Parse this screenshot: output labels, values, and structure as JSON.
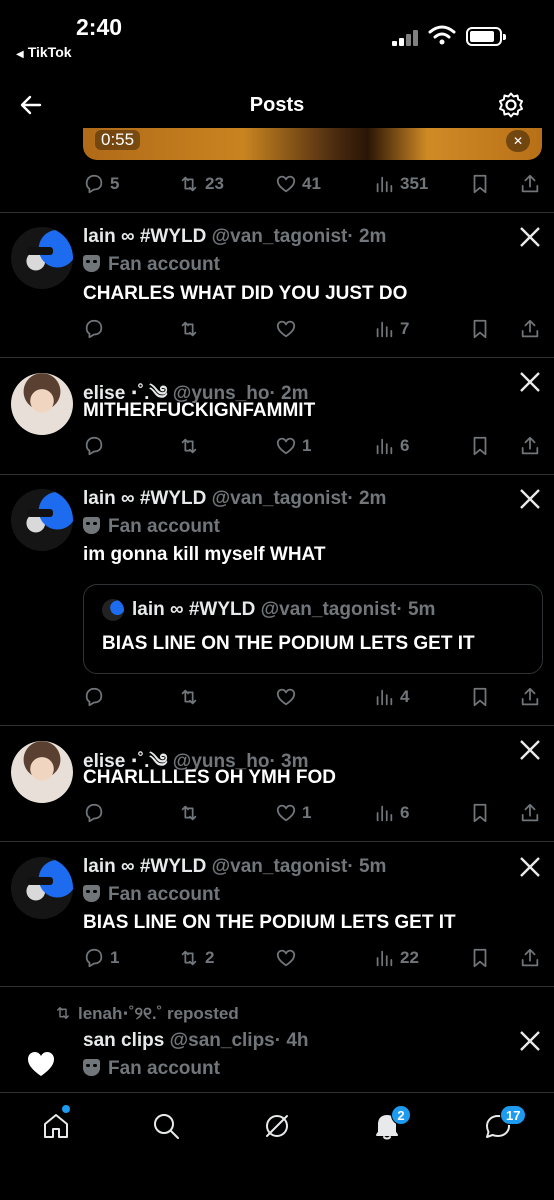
{
  "status_bar": {
    "time": "2:40",
    "back_app": "TikTok"
  },
  "header": {
    "title": "Posts"
  },
  "top_post": {
    "video_duration": "0:55",
    "replies": "5",
    "reposts": "23",
    "likes": "41",
    "views": "351"
  },
  "posts": [
    {
      "name": "lain ∞ #WYLD",
      "handle": "@van_tagonist",
      "time": "· 2m",
      "label": "Fan account",
      "text": "CHARLES WHAT DID YOU JUST DO",
      "replies": "",
      "reposts": "",
      "likes": "",
      "views": "7"
    },
    {
      "name": "elise ⋅˚.༄",
      "handle": "@yuns_ho",
      "time": "· 2m",
      "label": "",
      "text": "MITHERFUCKIGNFAMMIT",
      "replies": "",
      "reposts": "",
      "likes": "1",
      "views": "6"
    },
    {
      "name": "lain ∞ #WYLD",
      "handle": "@van_tagonist",
      "time": "· 2m",
      "label": "Fan account",
      "text": "im gonna kill myself WHAT",
      "replies": "",
      "reposts": "",
      "likes": "",
      "views": "4",
      "quote": {
        "name": "lain ∞ #WYLD",
        "handle": "@van_tagonist",
        "time": "· 5m",
        "text": "BIAS LINE ON THE PODIUM LETS GET IT"
      }
    },
    {
      "name": "elise ⋅˚.༄",
      "handle": "@yuns_ho",
      "time": "· 3m",
      "label": "",
      "text": "CHARLLLLES OH YMH FOD",
      "replies": "",
      "reposts": "",
      "likes": "1",
      "views": "6"
    },
    {
      "name": "lain ∞ #WYLD",
      "handle": "@van_tagonist",
      "time": "· 5m",
      "label": "Fan account",
      "text": "BIAS LINE ON THE PODIUM LETS GET IT",
      "replies": "1",
      "reposts": "2",
      "likes": "",
      "views": "22"
    },
    {
      "name": "san clips",
      "handle": "@san_clips",
      "time": "· 4h",
      "label": "Fan account",
      "repost_by": "lenah⋅˚୨୧.˚ reposted",
      "text": "..."
    }
  ],
  "bottom_nav": {
    "notif_badge": "2",
    "msg_badge": "17"
  },
  "icons": [
    "back-arrow-icon",
    "gear-icon",
    "reply-icon",
    "repost-icon",
    "like-icon",
    "views-icon",
    "bookmark-icon",
    "share-icon",
    "x-logo-icon",
    "home-icon",
    "search-icon",
    "grok-icon",
    "bell-icon",
    "messages-icon"
  ],
  "colors": {
    "background": "#000000",
    "text": "#e7e9ea",
    "muted": "#71767b",
    "accent": "#1d9bf0",
    "divider": "#2f3336"
  }
}
